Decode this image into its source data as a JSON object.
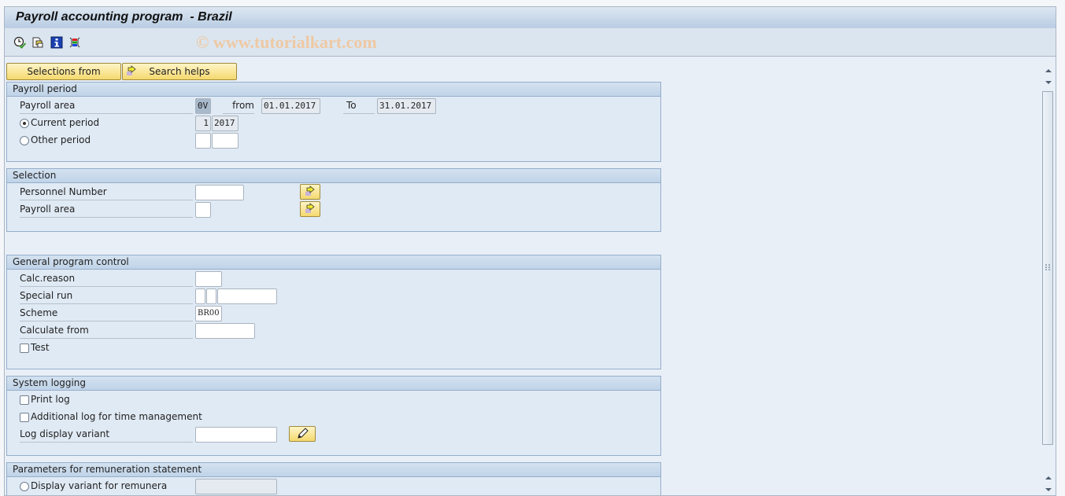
{
  "window": {
    "title": "Payroll accounting program  - Brazil",
    "watermark": "© www.tutorialkart.com"
  },
  "toolbar": {
    "icons": [
      "execute-icon",
      "get-variant-icon",
      "info-icon",
      "selection-options-icon"
    ]
  },
  "buttons": {
    "selections_from": "Selections from",
    "search_helps": "Search helps"
  },
  "payroll_period": {
    "header": "Payroll period",
    "payroll_area_label": "Payroll area",
    "payroll_area_value": "0V",
    "from_label": "from",
    "from_value": "01.01.2017",
    "to_label": "To",
    "to_value": "31.01.2017",
    "current_period_label": "Current period",
    "current_period_selected": true,
    "current_period_number": "1",
    "current_period_year": "2017",
    "other_period_label": "Other period",
    "other_period_selected": false,
    "other_period_number": "",
    "other_period_year": ""
  },
  "selection": {
    "header": "Selection",
    "personnel_number_label": "Personnel Number",
    "personnel_number_value": "",
    "payroll_area_label": "Payroll area",
    "payroll_area_value": ""
  },
  "general_program_control": {
    "header": "General program control",
    "calc_reason_label": "Calc.reason",
    "calc_reason_value": "",
    "special_run_label": "Special run",
    "special_run_values": [
      "",
      "",
      ""
    ],
    "scheme_label": "Scheme",
    "scheme_value": "BR00",
    "calculate_from_label": "Calculate from",
    "calculate_from_value": "",
    "test_label": "Test",
    "test_checked": false
  },
  "system_logging": {
    "header": "System logging",
    "print_log_label": "Print log",
    "print_log_checked": false,
    "additional_log_label": "Additional log for time management",
    "additional_log_checked": false,
    "log_display_variant_label": "Log display variant",
    "log_display_variant_value": ""
  },
  "remuneration": {
    "header": "Parameters for remuneration statement",
    "display_variant_label": "Display variant for remunera",
    "display_variant_selected": false,
    "display_variant_value": ""
  },
  "colors": {
    "button_yellow": "#f5d96e",
    "group_header": "#bfd3e8",
    "group_bg": "#e0eaf4"
  }
}
